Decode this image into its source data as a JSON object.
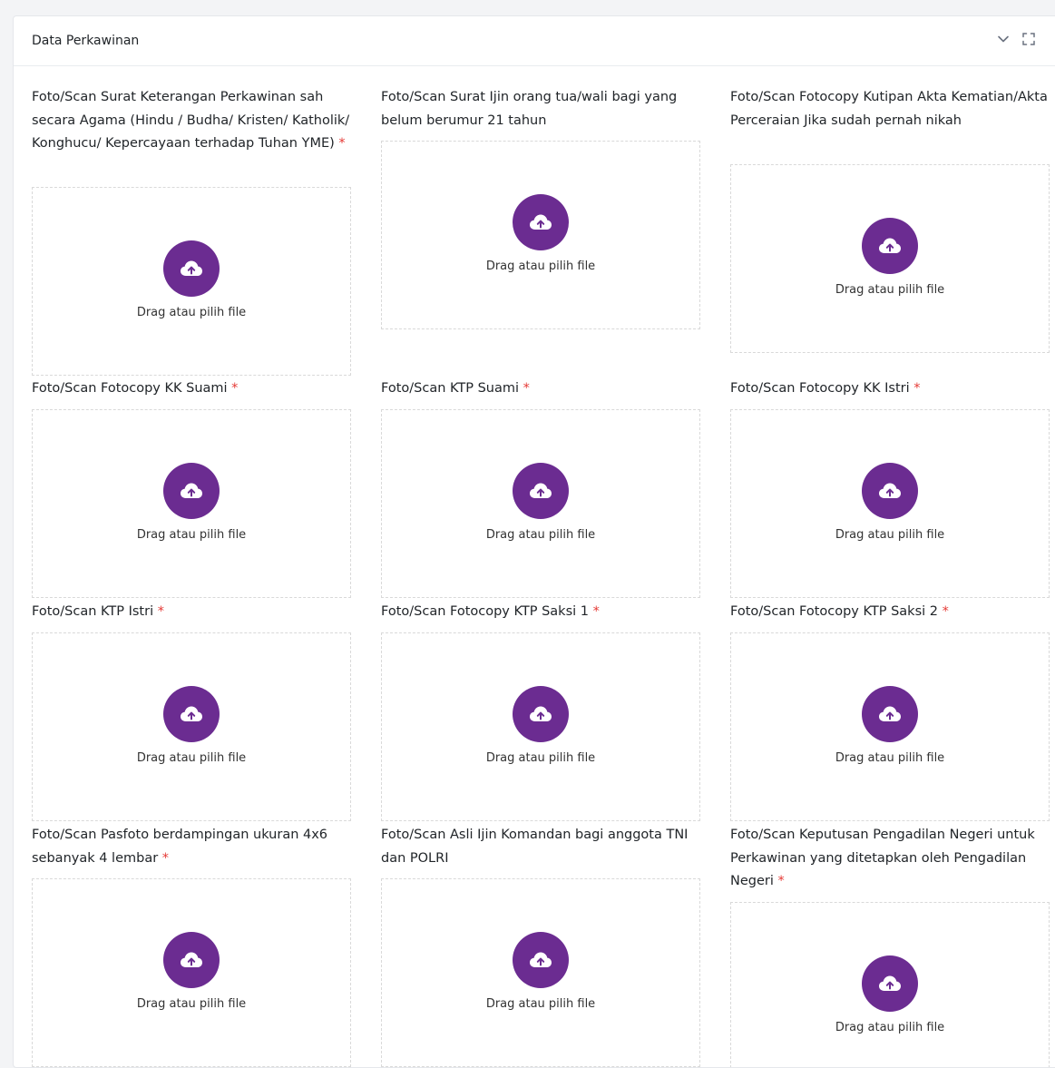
{
  "card": {
    "title": "Data Perkawinan",
    "icons": [
      "chevron-down-icon",
      "expand-icon"
    ]
  },
  "accent_color": "#6b2c91",
  "required_color": "#e53935",
  "fields": [
    {
      "label": "Foto/Scan Surat Keterangan Perkawinan sah secara Agama (Hindu / Budha/ Kristen/ Katholik/ Konghucu/ Kepercayaan terhadap Tuhan YME)",
      "required": "*",
      "dropzone_text": "Drag atau pilih file"
    },
    {
      "label": "Foto/Scan Surat Ijin orang tua/wali bagi yang belum berumur 21 tahun",
      "required": "",
      "dropzone_text": "Drag atau pilih file"
    },
    {
      "label": "Foto/Scan Fotocopy Kutipan Akta Kematian/Akta Perceraian Jika sudah pernah nikah",
      "required": "",
      "dropzone_text": "Drag atau pilih file"
    },
    {
      "label": "Foto/Scan Fotocopy KK Suami",
      "required": "*",
      "dropzone_text": "Drag atau pilih file"
    },
    {
      "label": "Foto/Scan KTP Suami",
      "required": "*",
      "dropzone_text": "Drag atau pilih file"
    },
    {
      "label": "Foto/Scan Fotocopy KK Istri",
      "required": "*",
      "dropzone_text": "Drag atau pilih file"
    },
    {
      "label": "Foto/Scan KTP Istri",
      "required": "*",
      "dropzone_text": "Drag atau pilih file"
    },
    {
      "label": "Foto/Scan Fotocopy KTP Saksi 1",
      "required": "*",
      "dropzone_text": "Drag atau pilih file"
    },
    {
      "label": "Foto/Scan Fotocopy KTP Saksi 2",
      "required": "*",
      "dropzone_text": "Drag atau pilih file"
    },
    {
      "label": "Foto/Scan Pasfoto berdampingan ukuran 4x6 sebanyak 4 lembar",
      "required": "*",
      "dropzone_text": "Drag atau pilih file"
    },
    {
      "label": "Foto/Scan Asli Ijin Komandan bagi anggota TNI dan POLRI",
      "required": "",
      "dropzone_text": "Drag atau pilih file"
    },
    {
      "label": "Foto/Scan Keputusan Pengadilan Negeri untuk Perkawinan yang ditetapkan oleh Pengadilan Negeri",
      "required": "*",
      "dropzone_text": "Drag atau pilih file"
    }
  ]
}
